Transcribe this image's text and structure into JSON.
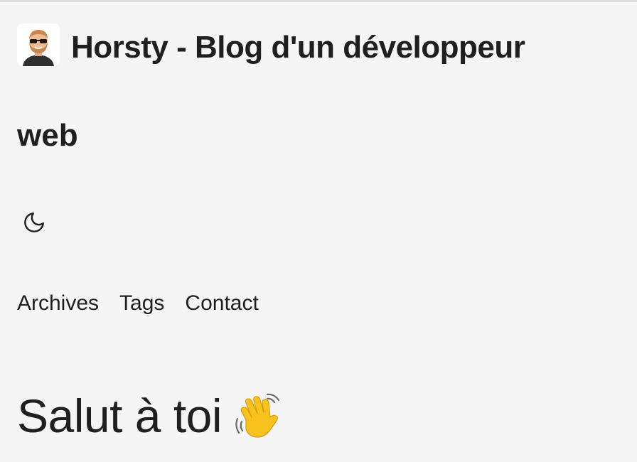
{
  "header": {
    "title_main": "Horsty - Blog d'un développeur",
    "title_cont": "web"
  },
  "theme_toggle": {
    "icon": "moon-icon"
  },
  "nav": {
    "items": [
      {
        "label": "Archives"
      },
      {
        "label": "Tags"
      },
      {
        "label": "Contact"
      }
    ]
  },
  "main": {
    "greeting": "Salut à toi",
    "greeting_icon": "waving-hand-icon"
  },
  "colors": {
    "background": "#f5f5f5",
    "text": "#1f1f1f",
    "hand": "#f7c21c"
  }
}
